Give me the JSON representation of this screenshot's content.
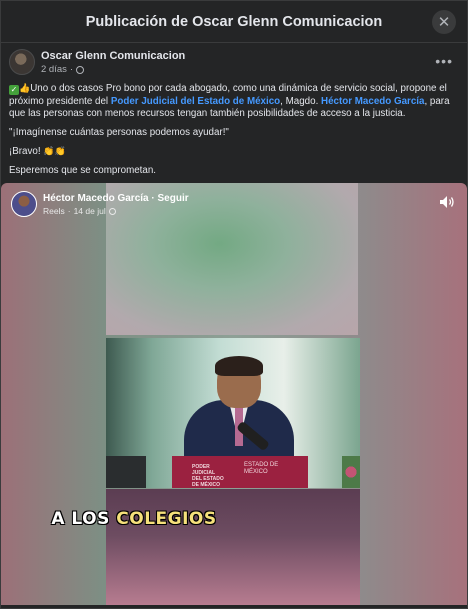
{
  "header": {
    "title": "Publicación de Oscar Glenn Comunicacion"
  },
  "post": {
    "author": "Oscar Glenn Comunicacion",
    "time": "2 días",
    "dot": "·",
    "text_1_pre": "Uno o dos casos Pro bono por cada abogado, como una dinámica de servicio social, propone el próximo presidente del ",
    "link_1": "Poder Judicial del Estado de México",
    "text_1_mid": ", Magdo. ",
    "link_2": "Héctor Macedo García",
    "text_1_post": ", para que las personas con menos recursos tengan también posibilidades de acceso a la justicia.",
    "quote": "\"¡Imagínense cuántas personas podemos ayudar!\"",
    "bravo": "¡Bravo!",
    "closing": "Esperemos que se comprometan."
  },
  "reel": {
    "author": "Héctor Macedo García",
    "follow": "Seguir",
    "sep": " · ",
    "type": "Reels",
    "date": "14 de jul",
    "caption_a": "A LOS ",
    "caption_b": "COLEGIOS",
    "lectern_left": "PODER JUDICIAL DEL ESTADO DE MÉXICO",
    "lectern_right": "ESTADO DE MÉXICO"
  }
}
